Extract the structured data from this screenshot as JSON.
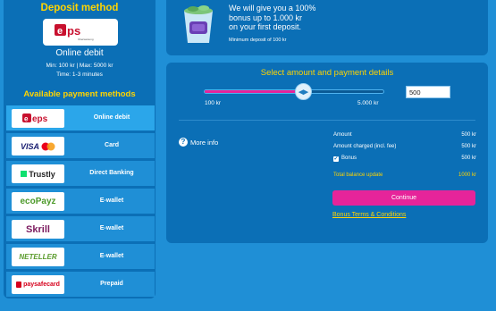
{
  "deposit_method": {
    "title": "Deposit method",
    "selected_logo": "eps",
    "selected_logo_sub": "Überweisung",
    "selected_name": "Online debit",
    "limits": "Min: 100 kr | Max: 5000 kr",
    "time": "Time: 1-3 minutes"
  },
  "available_methods": {
    "title": "Available payment methods",
    "items": [
      {
        "logo": "eps",
        "label": "Online debit",
        "active": true
      },
      {
        "logo": "VISA",
        "label": "Card"
      },
      {
        "logo": "Trustly",
        "label": "Direct Banking"
      },
      {
        "logo": "ecoPayz",
        "label": "E-wallet"
      },
      {
        "logo": "Skrill",
        "label": "E-wallet"
      },
      {
        "logo": "NETELLER",
        "label": "E-wallet"
      },
      {
        "logo": "paysafecard",
        "label": "Prepaid"
      }
    ]
  },
  "bonus": {
    "line1": "We will give you a 100%",
    "line2": "bonus up to 1.000 kr",
    "line3": "on your first deposit.",
    "min": "Minimum deposit of 100 kr"
  },
  "details": {
    "title": "Select amount and payment details",
    "slider_min": "100 kr",
    "slider_max": "5.000 kr",
    "slider_fraction": 0.55,
    "amount_value": "500",
    "more_info": "More info",
    "summary": {
      "amount_label": "Amount",
      "amount_value": "500 kr",
      "charged_label": "Amount charged (incl. fee)",
      "charged_value": "500 kr",
      "bonus_label": "Bonus",
      "bonus_value": "500 kr",
      "total_label": "Total balance update",
      "total_value": "1000 kr"
    },
    "continue_label": "Continue",
    "terms_label": "Bonus Terms & Conditions"
  },
  "colors": {
    "background": "#1f8fd6",
    "panel": "#0b6fb6",
    "accent_yellow": "#ffd400",
    "accent_pink": "#e6249a"
  }
}
